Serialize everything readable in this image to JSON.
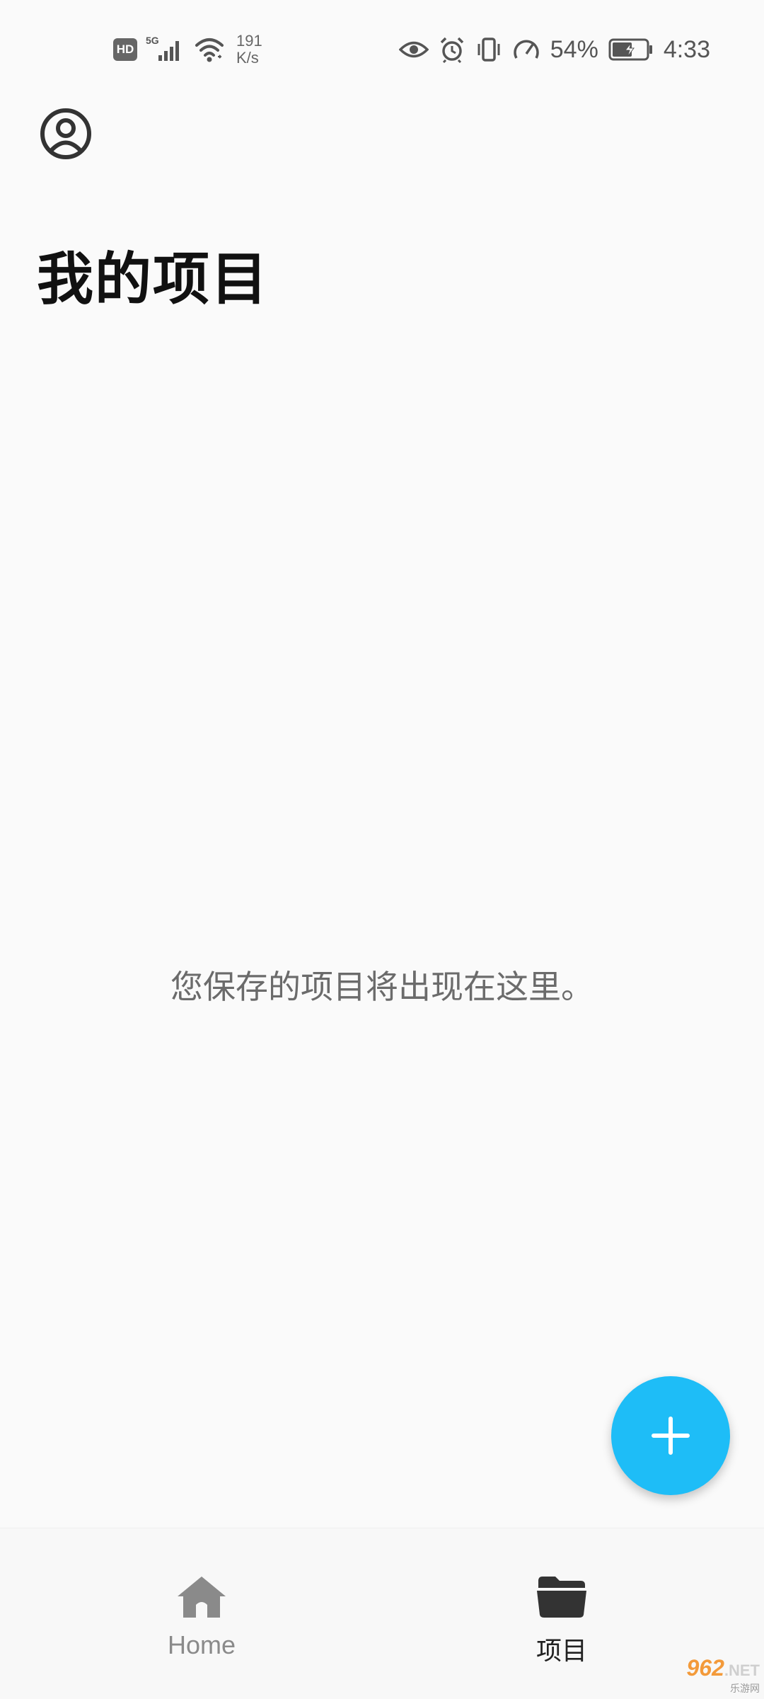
{
  "status_bar": {
    "hd": "HD",
    "network": "5G",
    "speed_value": "191",
    "speed_unit": "K/s",
    "battery": "54%",
    "time": "4:33"
  },
  "header": {
    "title": "我的项目"
  },
  "main": {
    "empty_message": "您保存的项目将出现在这里。"
  },
  "fab": {
    "icon": "plus-icon",
    "color": "#1ebdf7"
  },
  "bottom_nav": {
    "items": [
      {
        "label": "Home",
        "icon": "home-icon",
        "active": false
      },
      {
        "label": "项目",
        "icon": "folder-icon",
        "active": true
      }
    ]
  },
  "watermark": {
    "brand": "962",
    "suffix": ".NET",
    "sub": "乐游网"
  }
}
